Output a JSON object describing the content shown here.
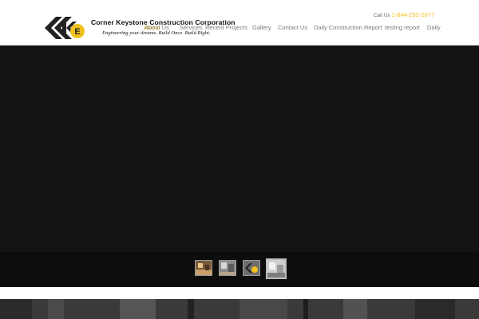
{
  "brand": {
    "name": "Corner Keystone Construction Corporation",
    "tagline": "Engineering your dreams. Build Once. Build Right.",
    "accent": "#f1c11d"
  },
  "contact": {
    "label": "Call Us",
    "phone": "1-844-252-2677"
  },
  "nav": {
    "items": [
      {
        "label": "Home",
        "active": true
      },
      {
        "label": "About Us"
      },
      {
        "label": "Services"
      },
      {
        "label": "Recent Projects"
      },
      {
        "label": "Gallery"
      },
      {
        "label": "Contact Us"
      },
      {
        "label": "Daily Construction Report"
      },
      {
        "label": "testing report"
      },
      {
        "label": "Daily"
      }
    ]
  },
  "slider": {
    "thumbnails": [
      {
        "name": "thumbnail-kitchen-icon"
      },
      {
        "name": "thumbnail-interior-icon"
      },
      {
        "name": "thumbnail-logo-icon"
      },
      {
        "name": "thumbnail-room-icon",
        "active": true
      }
    ]
  }
}
